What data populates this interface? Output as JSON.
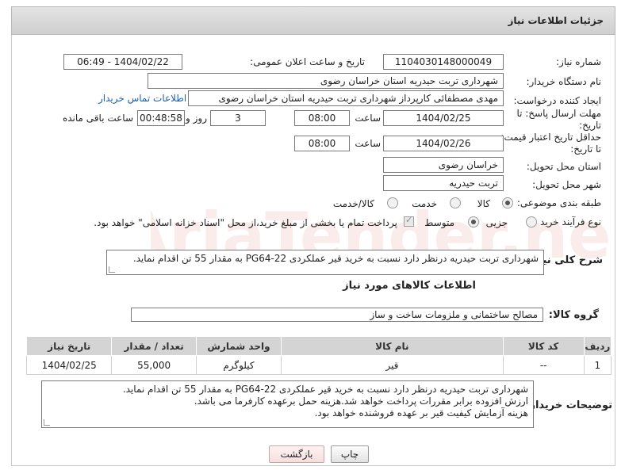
{
  "header": {
    "title": "جزئیات اطلاعات نیاز"
  },
  "need_number": {
    "label": "شماره نیاز:",
    "value": "1104030148000049"
  },
  "announce": {
    "label": "تاریخ و ساعت اعلان عمومی:",
    "value": "1404/02/22 - 06:49"
  },
  "buyer_org": {
    "label": "نام دستگاه خریدار:",
    "value": "شهرداری تربت حیدریه استان خراسان رضوی"
  },
  "requester": {
    "label": "ایجاد کننده درخواست:",
    "value": "مهدی مصطفائی کارپرداز شهرداری تربت حیدریه استان خراسان رضوی",
    "contact_link": "اطلاعات تماس خریدار"
  },
  "reply_deadline": {
    "label_line1": "مهلت ارسال پاسخ: تا",
    "label_line2": "تاریخ:",
    "date": "1404/02/25",
    "time_label": "ساعت",
    "time": "08:00",
    "days": "3",
    "days_label": "روز و",
    "remaining": "00:48:58",
    "remaining_label": "ساعت باقی مانده"
  },
  "price_validity": {
    "label_line1": "حداقل تاریخ اعتبار قیمت:",
    "label_line2": "تا تاریخ:",
    "date": "1404/02/26",
    "time_label": "ساعت",
    "time": "08:00"
  },
  "delivery_province": {
    "label": "استان محل تحویل:",
    "value": "خراسان رضوی"
  },
  "delivery_city": {
    "label": "شهر محل تحویل:",
    "value": "تربت حیدریه"
  },
  "category": {
    "label": "طبقه بندی موضوعی:",
    "options": [
      "کالا",
      "خدمت",
      "کالا/خدمت"
    ],
    "selected": "کالا"
  },
  "process": {
    "label": "نوع فرآیند خرید :",
    "options": [
      "جزیی",
      "متوسط"
    ],
    "selected": "متوسط",
    "payment_note": "پرداخت تمام یا بخشی از مبلغ خرید،از محل \"اسناد خزانه اسلامی\" خواهد بود."
  },
  "description": {
    "label": "شرح کلی نیاز:",
    "value": "شهرداری تربت حیدریه درنظر دارد نسبت به خرید قیر عملکردی PG64-22 به مقدار 55 تن اقدام نماید."
  },
  "goods_section": {
    "title": "اطلاعات کالاهای مورد نیاز"
  },
  "goods_group": {
    "label": "گروه کالا:",
    "value": "مصالح ساختمانی و ملزومات ساخت و ساز"
  },
  "table": {
    "headers": [
      "ردیف",
      "کد کالا",
      "نام کالا",
      "واحد شمارش",
      "تعداد / مقدار",
      "تاریخ نیاز"
    ],
    "rows": [
      [
        "1",
        "--",
        "قیر",
        "کیلوگرم",
        "55,000",
        "1404/02/25"
      ]
    ]
  },
  "buyer_notes": {
    "label": "توضیحات خریدار:",
    "lines": [
      "شهرداری تربت حیدریه درنظر دارد نسبت به خرید قیر عملکردی PG64-22 به مقدار 55 تن اقدام نماید.",
      "ارزش افزوده برابر مقررات پرداخت خواهد شد.هزینه حمل برعهده کارفرما می باشد.",
      "هزینه آزمایش کیفیت قیر بر عهده فروشنده خواهد بود."
    ]
  },
  "buttons": {
    "print": "چاپ",
    "back": "بازگشت"
  },
  "watermark": {
    "text": "AriaTender.net"
  }
}
